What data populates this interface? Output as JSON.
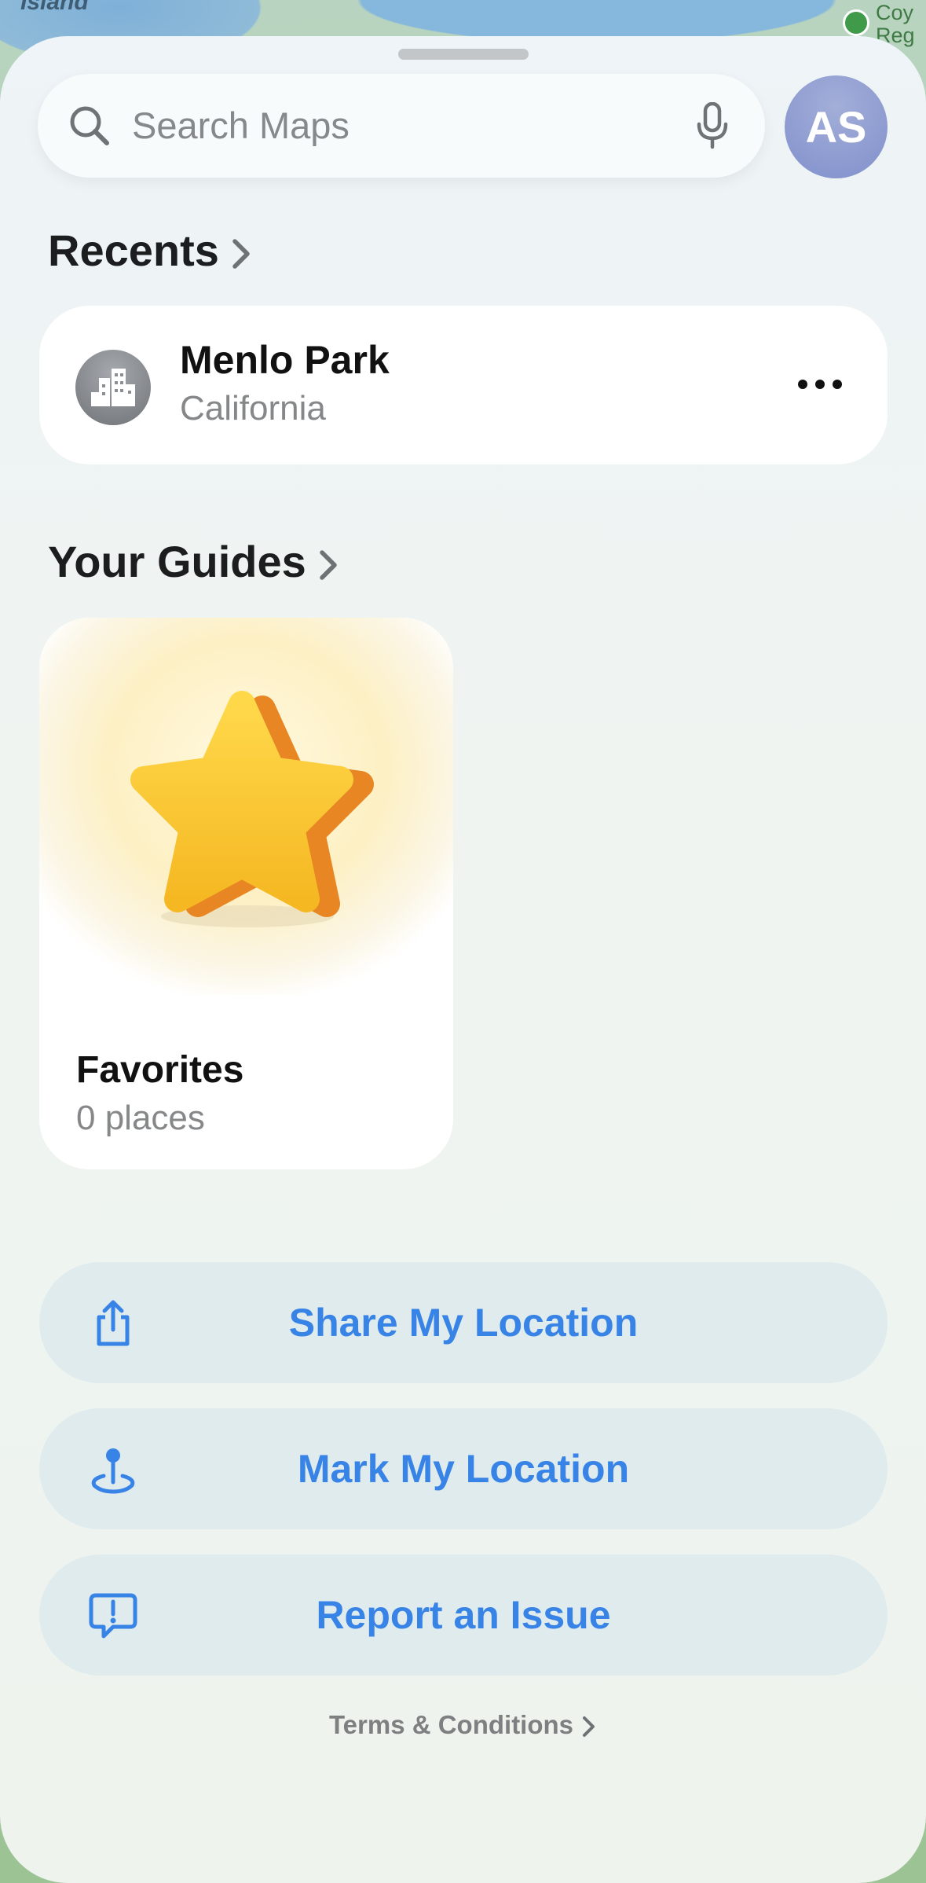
{
  "map": {
    "top_left_label": "Island",
    "top_right_label_line1": "Coy",
    "top_right_label_line2": "Reg"
  },
  "search": {
    "placeholder": "Search Maps",
    "icons": [
      "search-icon",
      "microphone-icon"
    ]
  },
  "profile": {
    "initials": "AS"
  },
  "recents": {
    "title": "Recents",
    "items": [
      {
        "name": "Menlo Park",
        "subtitle": "California",
        "icon": "city-icon"
      }
    ]
  },
  "guides": {
    "title": "Your Guides",
    "items": [
      {
        "name": "Favorites",
        "count": "0 places",
        "icon": "star-icon"
      }
    ]
  },
  "actions": [
    {
      "label": "Share My Location",
      "icon": "share-icon"
    },
    {
      "label": "Mark My Location",
      "icon": "location-pin-icon"
    },
    {
      "label": "Report an Issue",
      "icon": "report-icon"
    }
  ],
  "footer": {
    "terms": "Terms & Conditions"
  },
  "colors": {
    "accent": "#3783e6",
    "avatar": "#8a97d0",
    "action_bg": "#e0ebee"
  }
}
